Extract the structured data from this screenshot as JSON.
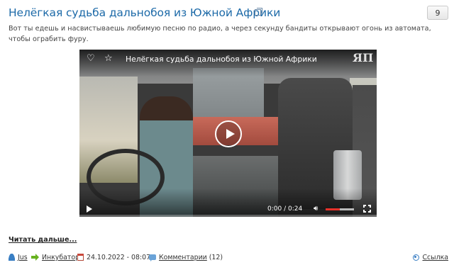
{
  "post": {
    "title": "Нелёгкая судьба дальнобоя из Южной Африки",
    "rating": "9",
    "description": "Вот ты едешь и насвистываешь любимую песню по радио, а через секунду бандиты открывают огонь из автомата, чтобы ограбить фуру.",
    "read_more": "Читать дальше..."
  },
  "video": {
    "title": "Нелёгкая судьба дальнобоя из Южной Африки",
    "logo": "ЯП",
    "current_time": "0:00",
    "separator": "/",
    "duration": "0:24",
    "volume_level": 0.5,
    "icons": {
      "favorite": "heart-icon",
      "star": "star-icon",
      "play": "play-icon",
      "volume": "volume-icon",
      "fullscreen": "fullscreen-icon"
    }
  },
  "meta": {
    "author": "Jus",
    "category": "Инкубатор",
    "date": "24.10.2022 - 08:07",
    "comments_label": "Комментарии",
    "comments_count": "(12)",
    "link_label": "Ссылка"
  },
  "colors": {
    "title_link": "#1d6aa8",
    "progress_accent": "#e5312a",
    "category_arrow": "#67b21f"
  }
}
